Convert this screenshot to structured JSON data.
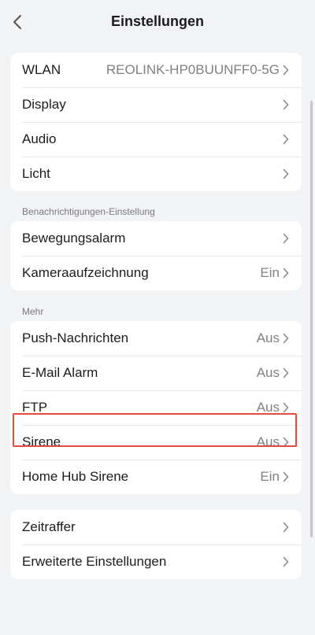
{
  "header": {
    "title": "Einstellungen",
    "back_icon": "chevron-left-icon"
  },
  "group1": {
    "rows": [
      {
        "label": "WLAN",
        "value": "REOLINK-HP0BUUNFF0-5G"
      },
      {
        "label": "Display",
        "value": ""
      },
      {
        "label": "Audio",
        "value": ""
      },
      {
        "label": "Licht",
        "value": ""
      }
    ]
  },
  "group2": {
    "section_label": "Benachrichtigungen-Einstellung",
    "rows": [
      {
        "label": "Bewegungsalarm",
        "value": ""
      },
      {
        "label": "Kameraaufzeichnung",
        "value": "Ein"
      }
    ]
  },
  "group3": {
    "section_label": "Mehr",
    "rows": [
      {
        "label": "Push-Nachrichten",
        "value": "Aus"
      },
      {
        "label": "E-Mail Alarm",
        "value": "Aus"
      },
      {
        "label": "FTP",
        "value": "Aus"
      },
      {
        "label": "Sirene",
        "value": "Aus"
      },
      {
        "label": "Home Hub Sirene",
        "value": "Ein"
      }
    ]
  },
  "group4": {
    "rows": [
      {
        "label": "Zeitraffer",
        "value": ""
      },
      {
        "label": "Erweiterte Einstellungen",
        "value": ""
      }
    ]
  },
  "colors": {
    "background": "#f2f3f5",
    "card": "#ffffff",
    "highlight": "#e24c3c",
    "secondary_text": "#808085"
  }
}
